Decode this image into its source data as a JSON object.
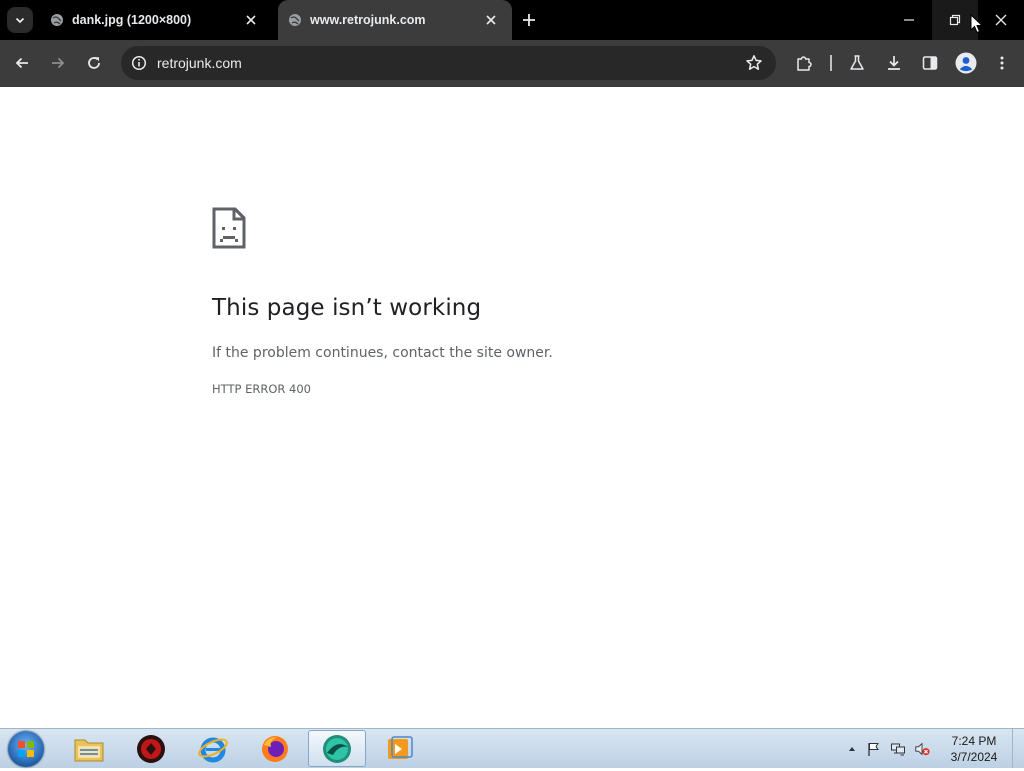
{
  "browser": {
    "tabs": [
      {
        "label": "dank.jpg (1200×800)",
        "active": false
      },
      {
        "label": "www.retrojunk.com",
        "active": true
      }
    ],
    "address_bar": {
      "url": "retrojunk.com"
    }
  },
  "error_page": {
    "title": "This page isn’t working",
    "description": "If the problem continues, contact the site owner.",
    "error_code": "HTTP ERROR 400"
  },
  "taskbar": {
    "clock": {
      "time": "7:24 PM",
      "date": "3/7/2024"
    }
  },
  "icons": {
    "tab_search": "chevron-down-icon",
    "favicon": "globe-icon",
    "close": "close-icon",
    "new_tab": "plus-icon",
    "back": "arrow-left-icon",
    "forward": "arrow-right-icon",
    "reload": "reload-icon",
    "site_info": "info-icon",
    "bookmark": "star-icon",
    "extensions": "puzzle-icon",
    "labs": "flask-icon",
    "downloads": "download-icon",
    "side_panel": "side-panel-icon",
    "profile": "avatar-icon",
    "menu": "kebab-menu-icon",
    "error": "sad-page-icon"
  },
  "colors": {
    "tab_strip": "#000000",
    "toolbar": "#3c3c3c",
    "omnibox": "#282828",
    "error_title": "#202124",
    "error_text": "#5f6368",
    "profile_accent": "#8ab4f8"
  }
}
